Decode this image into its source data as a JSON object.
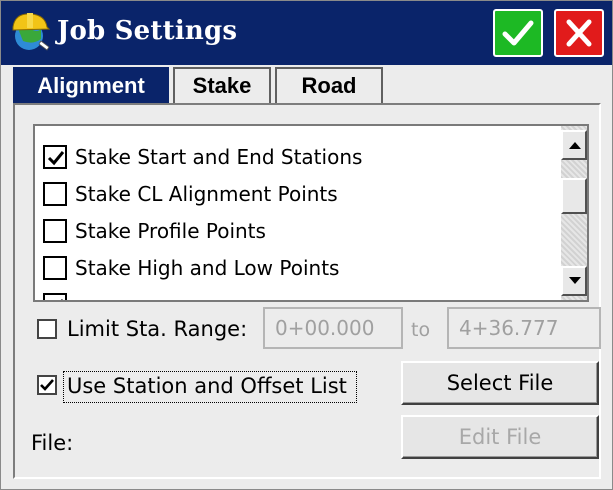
{
  "window": {
    "title": "Job Settings",
    "ok_icon": "checkmark-icon",
    "close_icon": "close-x-icon",
    "colors": {
      "titlebar": "#0a246a",
      "ok": "#1db924",
      "close": "#e11b1b"
    }
  },
  "tabs": [
    {
      "label": "Alignment",
      "active": true
    },
    {
      "label": "Stake",
      "active": false
    },
    {
      "label": "Road",
      "active": false
    }
  ],
  "stake_list": {
    "items": [
      {
        "label": "Stake Start and End Stations",
        "checked": true
      },
      {
        "label": "Stake CL Alignment Points",
        "checked": false
      },
      {
        "label": "Stake Profile Points",
        "checked": false
      },
      {
        "label": "Stake High and Low Points",
        "checked": false
      }
    ]
  },
  "limit_range": {
    "label": "Limit Sta. Range:",
    "checked": false,
    "from": "0+00.000",
    "to_label": "to",
    "to": "4+36.777"
  },
  "station_offset": {
    "label": "Use Station and Offset List",
    "checked": true
  },
  "buttons": {
    "select_file": "Select File",
    "edit_file": "Edit File"
  },
  "file_label": "File:"
}
